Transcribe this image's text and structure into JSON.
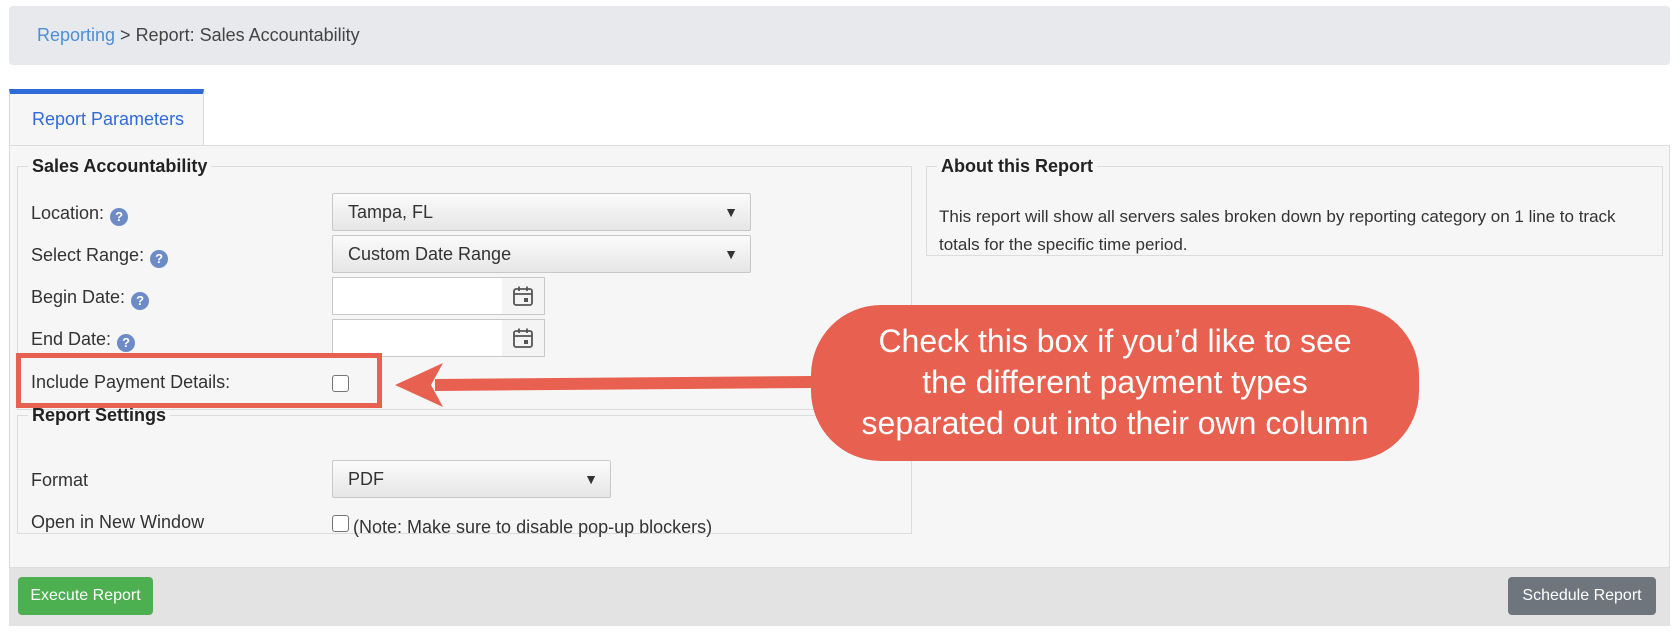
{
  "breadcrumb": {
    "root": "Reporting",
    "separator": " > ",
    "current": "Report: Sales Accountability"
  },
  "tabs": [
    {
      "label": "Report Parameters",
      "active": true
    }
  ],
  "sales_accountability": {
    "legend": "Sales Accountability",
    "location_label": "Location:",
    "location_value": "Tampa, FL",
    "range_label": "Select Range:",
    "range_value": "Custom Date Range",
    "begin_label": "Begin Date:",
    "begin_value": "",
    "end_label": "End Date:",
    "end_value": "",
    "payment_label": "Include Payment Details:",
    "payment_checked": false
  },
  "report_settings": {
    "legend": "Report Settings",
    "format_label": "Format",
    "format_value": "PDF",
    "new_window_label": "Open in New Window",
    "new_window_note": "(Note: Make sure to disable pop-up blockers)",
    "new_window_checked": false
  },
  "about": {
    "legend": "About this Report",
    "text": "This report will show all servers sales broken down by reporting category on 1 line to track totals for the specific time period."
  },
  "annotation": {
    "line1": "Check this box if you’d like to see",
    "line2": "the different payment types",
    "line3": "separated out into their own column",
    "color": "#e8604f"
  },
  "footer": {
    "execute_label": "Execute Report",
    "schedule_label": "Schedule Report"
  },
  "icons": {
    "help": "?",
    "dropdown": "▼",
    "calendar": "calendar-icon"
  },
  "colors": {
    "accent": "#2f6bd8",
    "link": "#4a8fd8",
    "execute": "#4caf50",
    "schedule": "#6f757d",
    "help_icon": "#6d8bc7"
  }
}
